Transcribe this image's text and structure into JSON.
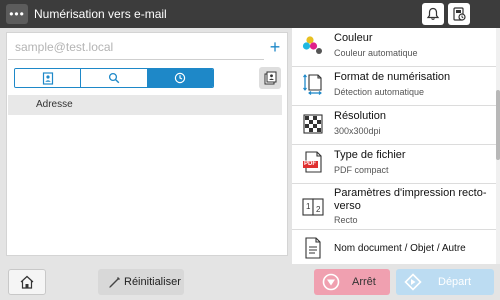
{
  "header": {
    "menu_glyph": "•••",
    "title": "Numérisation vers e-mail",
    "icons": [
      "bell-icon",
      "device-status-icon"
    ]
  },
  "address": {
    "placeholder": "sample@test.local",
    "add_glyph": "+",
    "tabs": [
      {
        "icon": "address-book-icon"
      },
      {
        "icon": "search-icon"
      },
      {
        "icon": "history-clock-icon",
        "active": true
      }
    ],
    "list_header": "Adresse"
  },
  "settings": {
    "items": [
      {
        "title": "Couleur",
        "value": "Couleur automatique",
        "icon": "color-icon"
      },
      {
        "title": "Format de numérisation",
        "value": "Détection automatique",
        "icon": "scan-size-icon"
      },
      {
        "title": "Résolution",
        "value": "300x300dpi",
        "icon": "resolution-icon"
      },
      {
        "title": "Type de fichier",
        "value": "PDF compact",
        "icon": "pdf-file-icon"
      },
      {
        "title": "Paramètres d'impression recto-verso",
        "value": "Recto",
        "icon": "duplex-icon"
      },
      {
        "title": "Nom document / Objet / Autre",
        "value": "",
        "icon": "document-icon"
      }
    ],
    "pdf_badge": "PDF",
    "duplex_digits": [
      "1",
      "2"
    ]
  },
  "footer": {
    "reset_label": "Réinitialiser",
    "stop_label": "Arrêt",
    "start_label": "Départ"
  },
  "colors": {
    "accent": "#1e88c8",
    "header_bg": "#3c3c3c",
    "stop_button": "#f0a0b0",
    "start_button_disabled": "#bcdcf2"
  }
}
